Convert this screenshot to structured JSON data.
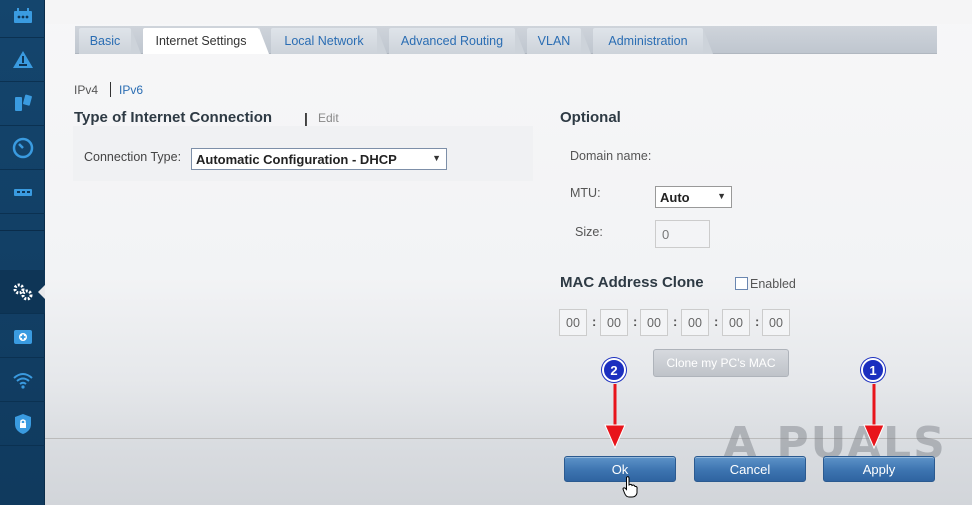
{
  "sidebar": {
    "icons": [
      "router-icon",
      "network-map-icon",
      "devices-icon",
      "speed-icon",
      "usb-icon",
      "settings-icon",
      "media-prioritization-icon",
      "wifi-icon",
      "security-icon"
    ]
  },
  "tabs": [
    {
      "label": "Basic"
    },
    {
      "label": "Internet Settings"
    },
    {
      "label": "Local Network"
    },
    {
      "label": "Advanced Routing"
    },
    {
      "label": "VLAN"
    },
    {
      "label": "Administration"
    }
  ],
  "protocol": {
    "ipv4": "IPv4",
    "ipv6": "IPv6"
  },
  "connection": {
    "title": "Type of Internet Connection",
    "separator": "|",
    "edit": "Edit",
    "type_label": "Connection Type:",
    "type_value": "Automatic Configuration - DHCP"
  },
  "optional": {
    "title": "Optional",
    "domain_label": "Domain name:",
    "mtu_label": "MTU:",
    "mtu_value": "Auto",
    "size_label": "Size:",
    "size_value": "0"
  },
  "mac_clone": {
    "title": "MAC Address Clone",
    "enabled_label": "Enabled",
    "segments": [
      "00",
      "00",
      "00",
      "00",
      "00",
      "00"
    ],
    "clone_button": "Clone my PC's MAC"
  },
  "footer": {
    "ok": "Ok",
    "cancel": "Cancel",
    "apply": "Apply"
  },
  "annotations": {
    "badge_1": "1",
    "badge_2": "2"
  },
  "watermark": "A PUALS",
  "colors": {
    "accent": "#3d74b0",
    "link": "#2a6db3",
    "annotation_arrow": "#e8141b",
    "badge": "#1b2fbf"
  }
}
